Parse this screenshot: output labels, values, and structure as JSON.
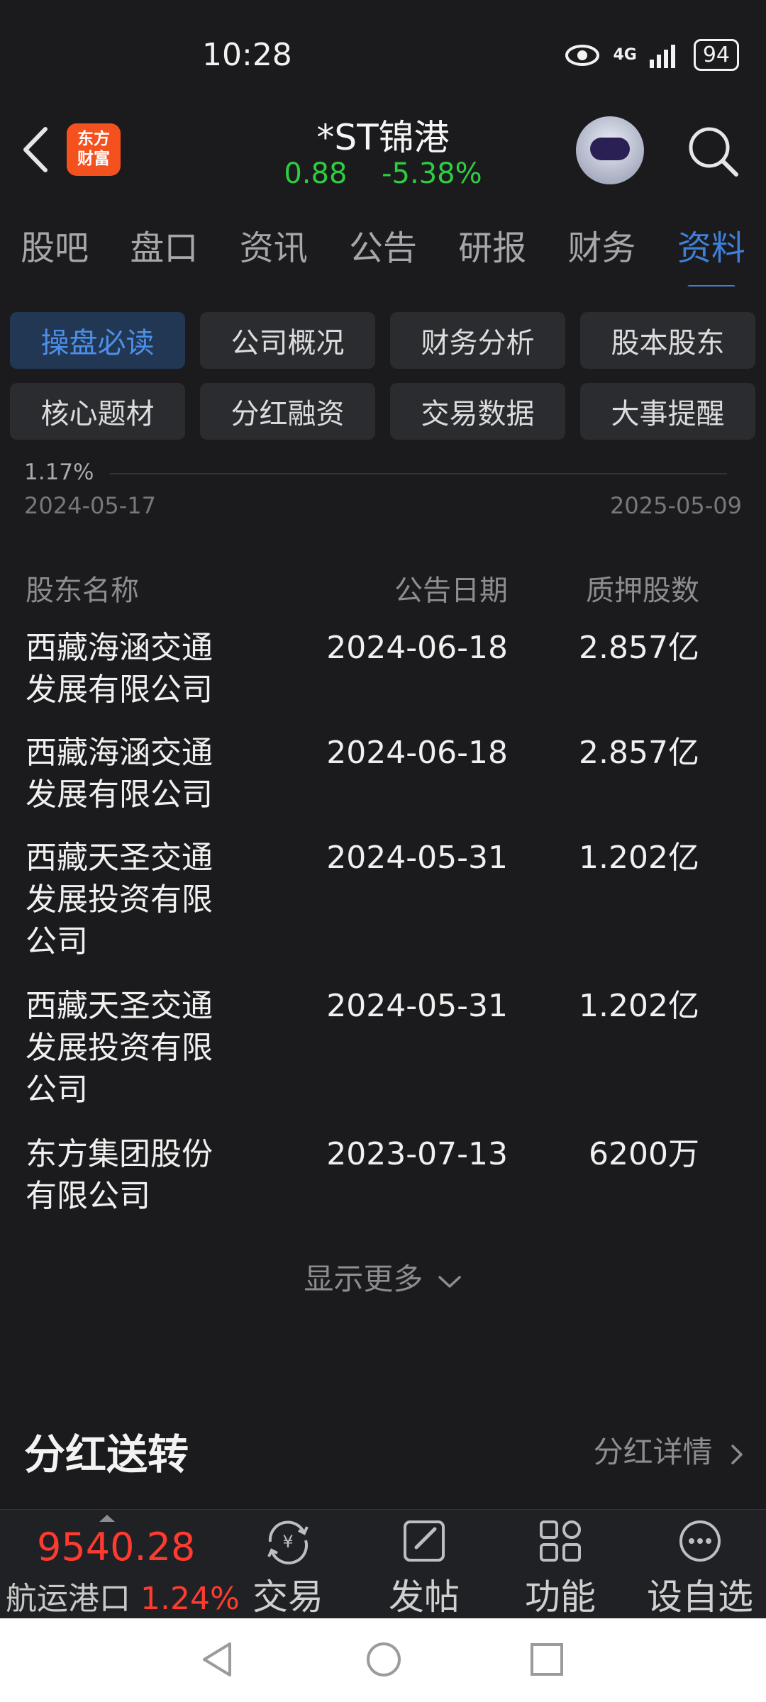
{
  "status": {
    "time": "10:28",
    "network": "4G",
    "battery": "94"
  },
  "header": {
    "logo_line1": "东方",
    "logo_line2": "财富",
    "stock_name": "*ST锦港",
    "price": "0.88",
    "change_pct": "-5.38%"
  },
  "tabs": [
    {
      "label": "股吧"
    },
    {
      "label": "盘口"
    },
    {
      "label": "资讯"
    },
    {
      "label": "公告"
    },
    {
      "label": "研报"
    },
    {
      "label": "财务"
    },
    {
      "label": "资料",
      "active": true
    }
  ],
  "sub_tabs": [
    {
      "label": "操盘必读",
      "active": true
    },
    {
      "label": "公司概况"
    },
    {
      "label": "财务分析"
    },
    {
      "label": "股本股东"
    },
    {
      "label": "核心题材"
    },
    {
      "label": "分红融资"
    },
    {
      "label": "交易数据"
    },
    {
      "label": "大事提醒"
    }
  ],
  "mini_chart": {
    "value_label": "1.17%",
    "start_date": "2024-05-17",
    "end_date": "2025-05-09"
  },
  "pledge_table": {
    "headers": [
      "股东名称",
      "公告日期",
      "质押股数"
    ],
    "rows": [
      {
        "name": "西藏海涵交通发展有限公司",
        "date": "2024-06-18",
        "shares": "2.857亿"
      },
      {
        "name": "西藏海涵交通发展有限公司",
        "date": "2024-06-18",
        "shares": "2.857亿"
      },
      {
        "name": "西藏天圣交通发展投资有限公司",
        "date": "2024-05-31",
        "shares": "1.202亿"
      },
      {
        "name": "西藏天圣交通发展投资有限公司",
        "date": "2024-05-31",
        "shares": "1.202亿"
      },
      {
        "name": "东方集团股份有限公司",
        "date": "2023-07-13",
        "shares": "6200万"
      }
    ],
    "show_more": "显示更多"
  },
  "dividend_section": {
    "title": "分红送转",
    "link": "分红详情"
  },
  "bottom_bar": {
    "index_value": "9540.28",
    "index_name": "航运港口",
    "index_change": "1.24%",
    "buttons": [
      {
        "label": "交易",
        "icon": "trade-icon"
      },
      {
        "label": "发帖",
        "icon": "post-icon"
      },
      {
        "label": "功能",
        "icon": "grid-icon"
      },
      {
        "label": "设自选",
        "icon": "more-icon"
      }
    ]
  },
  "colors": {
    "accent": "#3f7fd8",
    "down": "#2ecc40",
    "up": "#ff3b30",
    "logo": "#f4511e"
  }
}
